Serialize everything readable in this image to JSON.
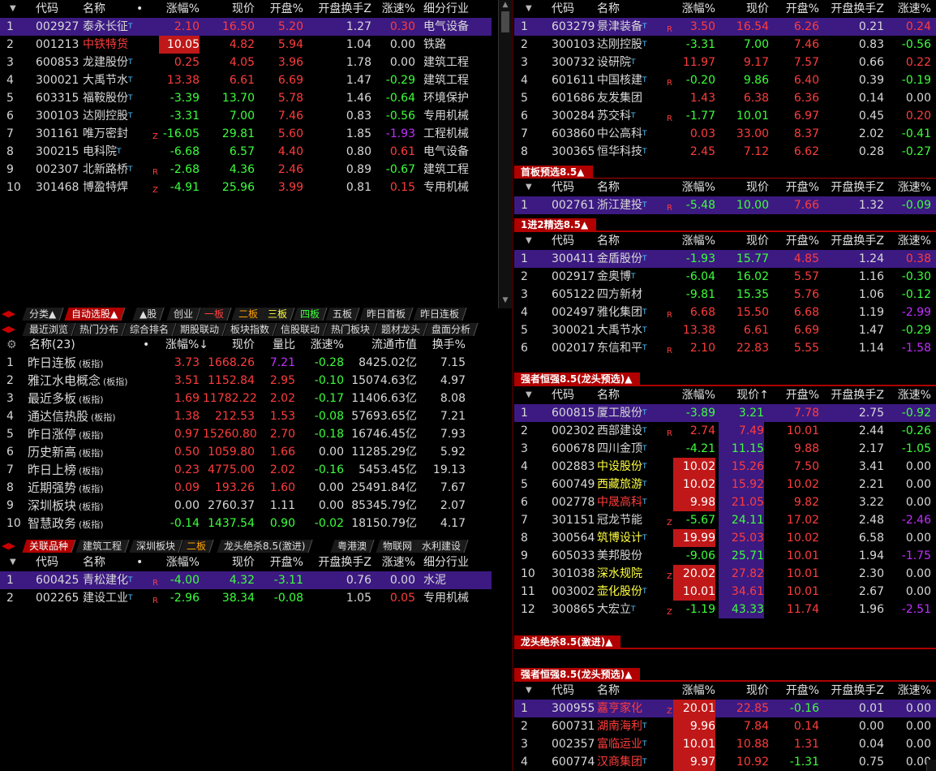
{
  "colors": {
    "up": "#ff3c3c",
    "down": "#3cff3c",
    "flat": "#d8d8d8",
    "yellow": "#ffff40",
    "purple": "#c030ff",
    "sel": "#3c1a82",
    "tag": "#b00000"
  },
  "pane1": {
    "headers": [
      "代码",
      "名称",
      "•",
      "涨幅%",
      "现价",
      "开盘%",
      "开盘换手Z",
      "涨速%",
      "细分行业"
    ],
    "rows": [
      {
        "n": "1",
        "code": "002927",
        "name": "泰永长征",
        "sup": "T",
        "flag": "",
        "chg": "2.10",
        "price": "16.50",
        "open": "5.20",
        "turn": "1.27",
        "spd": "0.30",
        "ind": "电气设备",
        "sel": true
      },
      {
        "n": "2",
        "code": "001213",
        "name": "中铁特货",
        "sup": "",
        "flag": "",
        "chg": "10.05",
        "price": "4.82",
        "open": "5.94",
        "turn": "1.04",
        "spd": "0.00",
        "ind": "铁路",
        "limit": true
      },
      {
        "n": "3",
        "code": "600853",
        "name": "龙建股份",
        "sup": "T",
        "flag": "",
        "chg": "0.25",
        "price": "4.05",
        "open": "3.96",
        "turn": "1.78",
        "spd": "0.00",
        "ind": "建筑工程"
      },
      {
        "n": "4",
        "code": "300021",
        "name": "大禹节水",
        "sup": "T",
        "flag": "",
        "chg": "13.38",
        "price": "6.61",
        "open": "6.69",
        "turn": "1.47",
        "spd": "-0.29",
        "ind": "建筑工程"
      },
      {
        "n": "5",
        "code": "603315",
        "name": "福鞍股份",
        "sup": "T",
        "flag": "",
        "chg": "-3.39",
        "price": "13.70",
        "open": "5.78",
        "turn": "1.46",
        "spd": "-0.64",
        "ind": "环境保护"
      },
      {
        "n": "6",
        "code": "300103",
        "name": "达刚控股",
        "sup": "T",
        "flag": "",
        "chg": "-3.31",
        "price": "7.00",
        "open": "7.46",
        "turn": "0.83",
        "spd": "-0.56",
        "ind": "专用机械"
      },
      {
        "n": "7",
        "code": "301161",
        "name": "唯万密封",
        "sup": "",
        "flag": "Z",
        "chg": "-16.05",
        "price": "29.81",
        "open": "5.60",
        "turn": "1.85",
        "spd": "-1.93",
        "ind": "工程机械",
        "spdPurple": true
      },
      {
        "n": "8",
        "code": "300215",
        "name": "电科院",
        "sup": "T",
        "flag": "",
        "chg": "-6.68",
        "price": "6.57",
        "open": "4.40",
        "turn": "0.80",
        "spd": "0.61",
        "ind": "电气设备"
      },
      {
        "n": "9",
        "code": "002307",
        "name": "北新路桥",
        "sup": "T",
        "flag": "R",
        "chg": "-2.68",
        "price": "4.36",
        "open": "2.46",
        "turn": "0.89",
        "spd": "-0.67",
        "ind": "建筑工程"
      },
      {
        "n": "10",
        "code": "301468",
        "name": "博盈特焊",
        "sup": "",
        "flag": "Z",
        "chg": "-4.91",
        "price": "25.96",
        "open": "3.99",
        "turn": "0.81",
        "spd": "0.15",
        "ind": "专用机械"
      }
    ]
  },
  "tabs1": [
    "分类▲",
    "自动选股▲",
    "▲股",
    "创业",
    "一板",
    "二板",
    "三板",
    "四板",
    "五板",
    "昨日首板",
    "昨日连板"
  ],
  "tabs2": [
    "最近浏览",
    "热门分布",
    "综合排名",
    "期股联动",
    "板块指数",
    "信股联动",
    "热门板块",
    "题材龙头",
    "盘面分析"
  ],
  "pane2": {
    "headers": [
      "名称(23)",
      "•",
      "涨幅%↓",
      "现价",
      "量比",
      "涨速%",
      "流通市值",
      "换手%"
    ],
    "rows": [
      {
        "n": "1",
        "name": "昨日连板",
        "tag": "(板指)",
        "chg": "3.73",
        "price": "1668.26",
        "vr": "7.21",
        "spd": "-0.28",
        "cap": "8425.02亿",
        "turn": "7.15",
        "vrPurple": true
      },
      {
        "n": "2",
        "name": "雅江水电概念",
        "tag": "(板指)",
        "chg": "3.51",
        "price": "1152.84",
        "vr": "2.95",
        "spd": "-0.10",
        "cap": "15074.63亿",
        "turn": "4.97"
      },
      {
        "n": "3",
        "name": "最近多板",
        "tag": "(板指)",
        "chg": "1.69",
        "price": "11782.22",
        "vr": "2.02",
        "spd": "-0.17",
        "cap": "11406.63亿",
        "turn": "8.08"
      },
      {
        "n": "4",
        "name": "通达信热股",
        "tag": "(板指)",
        "chg": "1.38",
        "price": "212.53",
        "vr": "1.53",
        "spd": "-0.08",
        "cap": "57693.65亿",
        "turn": "7.21"
      },
      {
        "n": "5",
        "name": "昨日涨停",
        "tag": "(板指)",
        "chg": "0.97",
        "price": "15260.80",
        "vr": "2.70",
        "spd": "-0.18",
        "cap": "16746.45亿",
        "turn": "7.93"
      },
      {
        "n": "6",
        "name": "历史新高",
        "tag": "(板指)",
        "chg": "0.50",
        "price": "1059.80",
        "vr": "1.66",
        "spd": "0.00",
        "cap": "11285.29亿",
        "turn": "5.92"
      },
      {
        "n": "7",
        "name": "昨日上榜",
        "tag": "(板指)",
        "chg": "0.23",
        "price": "4775.00",
        "vr": "2.02",
        "spd": "-0.16",
        "cap": "5453.45亿",
        "turn": "19.13"
      },
      {
        "n": "8",
        "name": "近期强势",
        "tag": "(板指)",
        "chg": "0.09",
        "price": "193.26",
        "vr": "1.60",
        "spd": "0.00",
        "cap": "25491.84亿",
        "turn": "7.67"
      },
      {
        "n": "9",
        "name": "深圳板块",
        "tag": "(板指)",
        "chg": "0.00",
        "price": "2760.37",
        "vr": "1.11",
        "spd": "0.00",
        "cap": "85345.79亿",
        "turn": "2.07"
      },
      {
        "n": "10",
        "name": "智慧政务",
        "tag": "(板指)",
        "chg": "-0.14",
        "price": "1437.54",
        "vr": "0.90",
        "spd": "-0.02",
        "cap": "18150.79亿",
        "turn": "4.17"
      }
    ]
  },
  "tabs3": [
    "关联品种",
    "建筑工程",
    "深圳板块",
    "二板",
    "龙头绝杀8.5(激进)",
    "粤港澳",
    "物联网",
    "水利建设"
  ],
  "pane3": {
    "headers": [
      "代码",
      "名称",
      "•",
      "涨幅%",
      "现价",
      "开盘%",
      "开盘换手Z",
      "涨速%",
      "细分行业"
    ],
    "rows": [
      {
        "n": "1",
        "code": "600425",
        "name": "青松建化",
        "sup": "T",
        "flag": "R",
        "chg": "-4.00",
        "price": "4.32",
        "open": "-3.11",
        "turn": "0.76",
        "spd": "0.00",
        "ind": "水泥",
        "sel": true
      },
      {
        "n": "2",
        "code": "002265",
        "name": "建设工业",
        "sup": "T",
        "flag": "R",
        "chg": "-2.96",
        "price": "38.34",
        "open": "-0.08",
        "turn": "1.05",
        "spd": "0.05",
        "ind": "专用机械"
      }
    ]
  },
  "rheaders": [
    "代码",
    "名称",
    "涨幅%",
    "现价",
    "开盘%",
    "开盘换手Z",
    "涨速%"
  ],
  "r1": [
    {
      "n": "1",
      "code": "603279",
      "name": "景津装备",
      "sup": "T",
      "flag": "R",
      "chg": "3.50",
      "price": "16.54",
      "open": "6.26",
      "turn": "0.21",
      "spd": "0.24",
      "sel": true
    },
    {
      "n": "2",
      "code": "300103",
      "name": "达刚控股",
      "sup": "T",
      "flag": "",
      "chg": "-3.31",
      "price": "7.00",
      "open": "7.46",
      "turn": "0.83",
      "spd": "-0.56"
    },
    {
      "n": "3",
      "code": "300732",
      "name": "设研院",
      "sup": "T",
      "flag": "",
      "chg": "11.97",
      "price": "9.17",
      "open": "7.57",
      "turn": "0.66",
      "spd": "0.22"
    },
    {
      "n": "4",
      "code": "601611",
      "name": "中国核建",
      "sup": "T",
      "flag": "R",
      "chg": "-0.20",
      "price": "9.86",
      "open": "6.40",
      "turn": "0.39",
      "spd": "-0.19"
    },
    {
      "n": "5",
      "code": "601686",
      "name": "友发集团",
      "sup": "",
      "flag": "",
      "chg": "1.43",
      "price": "6.38",
      "open": "6.36",
      "turn": "0.14",
      "spd": "0.00"
    },
    {
      "n": "6",
      "code": "300284",
      "name": "苏交科",
      "sup": "T",
      "flag": "R",
      "chg": "-1.77",
      "price": "10.01",
      "open": "6.97",
      "turn": "0.45",
      "spd": "0.20"
    },
    {
      "n": "7",
      "code": "603860",
      "name": "中公高科",
      "sup": "T",
      "flag": "",
      "chg": "0.03",
      "price": "33.00",
      "open": "8.37",
      "turn": "2.02",
      "spd": "-0.41"
    },
    {
      "n": "8",
      "code": "300365",
      "name": "恒华科技",
      "sup": "T",
      "flag": "",
      "chg": "2.45",
      "price": "7.12",
      "open": "6.62",
      "turn": "0.28",
      "spd": "-0.27"
    }
  ],
  "t2": "首板预选8.5▲",
  "r2": [
    {
      "n": "1",
      "code": "002761",
      "name": "浙江建投",
      "sup": "T",
      "flag": "R",
      "chg": "-5.48",
      "price": "10.00",
      "open": "7.66",
      "turn": "1.32",
      "spd": "-0.09",
      "sel": true
    }
  ],
  "t3": "1进2精选8.5▲",
  "r3": [
    {
      "n": "1",
      "code": "300411",
      "name": "金盾股份",
      "sup": "T",
      "flag": "",
      "chg": "-1.93",
      "price": "15.77",
      "open": "4.85",
      "turn": "1.24",
      "spd": "0.38",
      "sel": true
    },
    {
      "n": "2",
      "code": "002917",
      "name": "金奥博",
      "sup": "T",
      "flag": "",
      "chg": "-6.04",
      "price": "16.02",
      "open": "5.57",
      "turn": "1.16",
      "spd": "-0.30"
    },
    {
      "n": "3",
      "code": "605122",
      "name": "四方新材",
      "sup": "",
      "flag": "",
      "chg": "-9.81",
      "price": "15.35",
      "open": "5.76",
      "turn": "1.06",
      "spd": "-0.12"
    },
    {
      "n": "4",
      "code": "002497",
      "name": "雅化集团",
      "sup": "T",
      "flag": "R",
      "chg": "6.68",
      "price": "15.50",
      "open": "6.68",
      "turn": "1.19",
      "spd": "-2.99",
      "spdPurple": true
    },
    {
      "n": "5",
      "code": "300021",
      "name": "大禹节水",
      "sup": "T",
      "flag": "",
      "chg": "13.38",
      "price": "6.61",
      "open": "6.69",
      "turn": "1.47",
      "spd": "-0.29"
    },
    {
      "n": "6",
      "code": "002017",
      "name": "东信和平",
      "sup": "T",
      "flag": "R",
      "chg": "2.10",
      "price": "22.83",
      "open": "5.55",
      "turn": "1.14",
      "spd": "-1.58",
      "spdPurple": true
    }
  ],
  "t4": "强者恒强8.5(龙头预选)▲",
  "r4headers": [
    "代码",
    "名称",
    "涨幅%",
    "现价↑",
    "开盘%",
    "开盘换手Z",
    "涨速%"
  ],
  "r4": [
    {
      "n": "1",
      "code": "600815",
      "name": "厦工股份",
      "sup": "T",
      "flag": "",
      "chg": "-3.89",
      "price": "3.21",
      "open": "7.78",
      "turn": "2.75",
      "spd": "-0.92",
      "sel": true
    },
    {
      "n": "2",
      "code": "002302",
      "name": "西部建设",
      "sup": "T",
      "flag": "R",
      "chg": "2.74",
      "price": "7.49",
      "open": "10.01",
      "turn": "2.44",
      "spd": "-0.26"
    },
    {
      "n": "3",
      "code": "600678",
      "name": "四川金顶",
      "sup": "T",
      "flag": "",
      "chg": "-4.21",
      "price": "11.15",
      "open": "9.88",
      "turn": "2.17",
      "spd": "-1.05"
    },
    {
      "n": "4",
      "code": "002883",
      "name": "中设股份",
      "sup": "T",
      "flag": "",
      "chg": "10.02",
      "price": "15.26",
      "open": "7.50",
      "turn": "3.41",
      "spd": "0.00",
      "limit": true,
      "nameYellow": true
    },
    {
      "n": "5",
      "code": "600749",
      "name": "西藏旅游",
      "sup": "T",
      "flag": "",
      "chg": "10.02",
      "price": "15.92",
      "open": "10.02",
      "turn": "2.21",
      "spd": "0.00",
      "limit": true,
      "nameYellow": true
    },
    {
      "n": "6",
      "code": "002778",
      "name": "中晟高科",
      "sup": "T",
      "flag": "",
      "chg": "9.98",
      "price": "21.05",
      "open": "9.82",
      "turn": "3.22",
      "spd": "0.00",
      "limit": true,
      "nameRed": true
    },
    {
      "n": "7",
      "code": "301151",
      "name": "冠龙节能",
      "sup": "",
      "flag": "Z",
      "chg": "-5.67",
      "price": "24.11",
      "open": "17.02",
      "turn": "2.48",
      "spd": "-2.46",
      "spdPurple": true
    },
    {
      "n": "8",
      "code": "300564",
      "name": "筑博设计",
      "sup": "T",
      "flag": "",
      "chg": "19.99",
      "price": "25.03",
      "open": "10.02",
      "turn": "6.58",
      "spd": "0.00",
      "limit": true,
      "nameYellow": true
    },
    {
      "n": "9",
      "code": "605033",
      "name": "美邦股份",
      "sup": "",
      "flag": "",
      "chg": "-9.06",
      "price": "25.71",
      "open": "10.01",
      "turn": "1.94",
      "spd": "-1.75",
      "spdPurple": true
    },
    {
      "n": "10",
      "code": "301038",
      "name": "深水规院",
      "sup": "",
      "flag": "Z",
      "chg": "20.02",
      "price": "27.82",
      "open": "10.01",
      "turn": "2.30",
      "spd": "0.00",
      "limit": true,
      "nameYellow": true
    },
    {
      "n": "11",
      "code": "003002",
      "name": "壶化股份",
      "sup": "T",
      "flag": "",
      "chg": "10.01",
      "price": "34.61",
      "open": "10.01",
      "turn": "2.67",
      "spd": "0.00",
      "limit": true,
      "nameYellow": true
    },
    {
      "n": "12",
      "code": "300865",
      "name": "大宏立",
      "sup": "T",
      "flag": "Z",
      "chg": "-1.19",
      "price": "43.33",
      "open": "11.74",
      "turn": "1.96",
      "spd": "-2.51",
      "spdPurple": true
    }
  ],
  "t5": "龙头绝杀8.5(激进)▲",
  "t6": "强者恒强8.5(龙头预选)▲",
  "r6": [
    {
      "n": "1",
      "code": "300955",
      "name": "嘉亨家化",
      "sup": "",
      "flag": "Z",
      "chg": "20.01",
      "price": "22.85",
      "open": "-0.16",
      "turn": "0.01",
      "spd": "0.00",
      "limit": true,
      "nameRed": true,
      "sel": true
    },
    {
      "n": "2",
      "code": "600731",
      "name": "湖南海利",
      "sup": "T",
      "flag": "",
      "chg": "9.96",
      "price": "7.84",
      "open": "0.14",
      "turn": "0.00",
      "spd": "0.00",
      "limit": true,
      "nameRed": true
    },
    {
      "n": "3",
      "code": "002357",
      "name": "富临运业",
      "sup": "T",
      "flag": "",
      "chg": "10.01",
      "price": "10.88",
      "open": "1.31",
      "turn": "0.04",
      "spd": "0.00",
      "limit": true,
      "nameRed": true
    },
    {
      "n": "4",
      "code": "600774",
      "name": "汉商集团",
      "sup": "T",
      "flag": "",
      "chg": "9.97",
      "price": "10.92",
      "open": "-1.31",
      "turn": "0.75",
      "spd": "0.00",
      "limit": true,
      "nameRed": true
    }
  ]
}
